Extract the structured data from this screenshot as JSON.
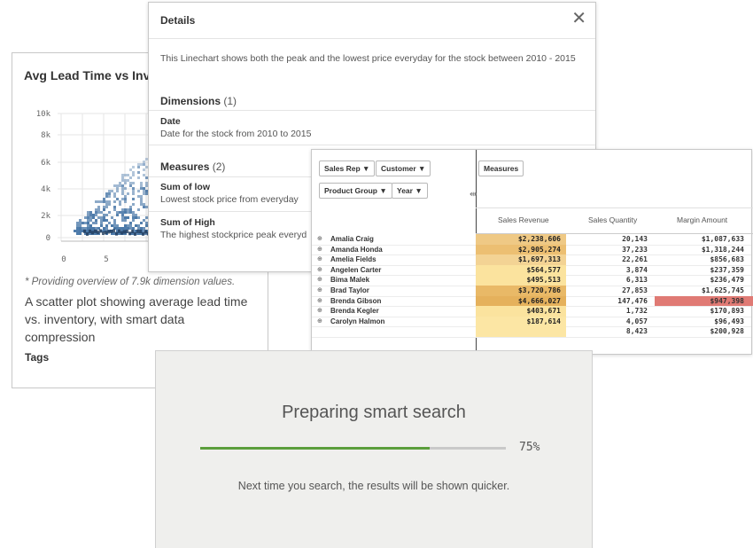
{
  "scatter_card": {
    "title": "Avg Lead Time vs Inve",
    "y_ticks": [
      "10k",
      "8k",
      "6k",
      "4k",
      "2k",
      "0"
    ],
    "x_ticks": [
      "0",
      "5"
    ],
    "overview_note": "* Providing overview of 7.9k dimension values.",
    "description": "A scatter plot showing average lead time vs. inventory, with smart data compression",
    "tags_label": "Tags",
    "point_color": "#4a78a8"
  },
  "details": {
    "title": "Details",
    "close_glyph": "✕",
    "description": "This Linechart shows both the peak and the lowest price everyday for the stock between 2010 - 2015",
    "dimensions_heading": "Dimensions",
    "dimensions_count": "(1)",
    "dimensions": [
      {
        "name": "Date",
        "description": "Date for the stock from 2010 to 2015"
      }
    ],
    "measures_heading": "Measures",
    "measures_count": "(2)",
    "measures": [
      {
        "name": "Sum of low",
        "description": "Lowest stock price from everyday"
      },
      {
        "name": "Sum of High",
        "description": "The highest stockprice peak everyd"
      }
    ]
  },
  "pivot": {
    "filters": {
      "sales_rep": "Sales Rep ▼",
      "customer": "Customer ▼",
      "product_group": "Product Group ▼",
      "year": "Year ▼",
      "measures": "Measures"
    },
    "resize_handle": "⇹",
    "expand_glyph": "⊕",
    "columns": [
      "Sales Revenue",
      "Sales Quantity",
      "Margin Amount"
    ],
    "rows": [
      {
        "rep": "Amalia Craig",
        "revenue": "$2,238,606",
        "quantity": "20,143",
        "margin": "$1,087,633",
        "rev_color": "#efc985",
        "margin_color": ""
      },
      {
        "rep": "Amanda Honda",
        "revenue": "$2,905,274",
        "quantity": "37,233",
        "margin": "$1,318,244",
        "rev_color": "#ecbf72",
        "margin_color": ""
      },
      {
        "rep": "Amelia Fields",
        "revenue": "$1,697,313",
        "quantity": "22,261",
        "margin": "$856,683",
        "rev_color": "#f3d394",
        "margin_color": ""
      },
      {
        "rep": "Angelen Carter",
        "revenue": "$564,577",
        "quantity": "3,874",
        "margin": "$237,359",
        "rev_color": "#fbe39e",
        "margin_color": ""
      },
      {
        "rep": "Bima Malek",
        "revenue": "$495,513",
        "quantity": "6,313",
        "margin": "$236,479",
        "rev_color": "#fbe39e",
        "margin_color": ""
      },
      {
        "rep": "Brad Taylor",
        "revenue": "$3,720,786",
        "quantity": "27,853",
        "margin": "$1,625,745",
        "rev_color": "#e9b967",
        "margin_color": ""
      },
      {
        "rep": "Brenda Gibson",
        "revenue": "$4,666,027",
        "quantity": "147,476",
        "margin": "$947,398",
        "rev_color": "#e5b15c",
        "margin_color": "#e07a74"
      },
      {
        "rep": "Brenda Kegler",
        "revenue": "$403,671",
        "quantity": "1,732",
        "margin": "$170,893",
        "rev_color": "#fbe39e",
        "margin_color": ""
      },
      {
        "rep": "Carolyn Halmon",
        "revenue": "$187,614",
        "quantity": "4,057",
        "margin": "$96,493",
        "rev_color": "#fce6a4",
        "margin_color": ""
      },
      {
        "rep": "",
        "revenue": "",
        "quantity": "8,423",
        "margin": "$200,928",
        "rev_color": "#fce6a4",
        "margin_color": ""
      }
    ]
  },
  "progress": {
    "title": "Preparing smart search",
    "percent": 75,
    "percent_label": "75%",
    "note": "Next time you search, the results will be shown quicker.",
    "fill_color": "#5b9e3c"
  }
}
